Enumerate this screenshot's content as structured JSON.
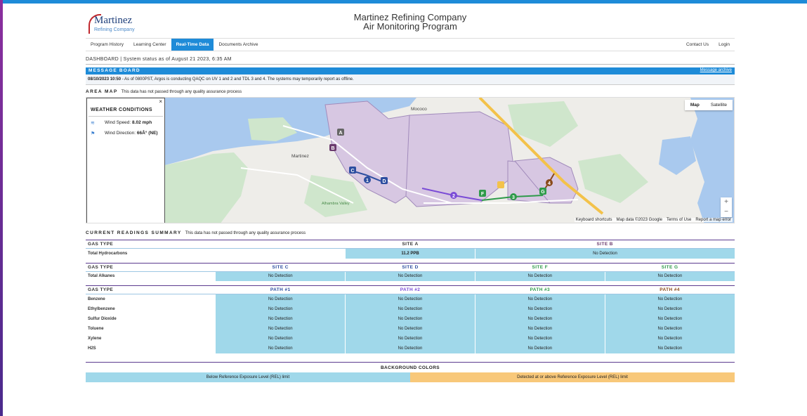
{
  "header": {
    "logo_name": "Martinez",
    "logo_sub": "Refining Company",
    "title_line1": "Martinez Refining Company",
    "title_line2": "Air Monitoring Program"
  },
  "nav": {
    "items": [
      "Program History",
      "Learning Center",
      "Real-Time Data",
      "Documents Archive"
    ],
    "active": "Real-Time Data",
    "right": [
      "Contact Us",
      "Login"
    ]
  },
  "dashboard": "DASHBOARD | System status as of August 21 2023, 6:35 AM",
  "message_board": {
    "title": "MESSAGE BOARD",
    "archive_link": "Message archive",
    "date": "08/10/2023 10:50",
    "text": " - As of 0800PST, Argos is conducting QAQC on UV 1 and 2 and TDL 3 and 4. The systems may temporarily report as offline."
  },
  "area_map": {
    "title": "AREA MAP",
    "note": "This data has not passed through any quality assurance process",
    "weather": {
      "title": "WEATHER CONDITIONS",
      "close": "×",
      "wind_speed_label": "Wind Speed: ",
      "wind_speed_value": "8.02 mph",
      "wind_dir_label": "Wind Direction: ",
      "wind_dir_value": "66Â° (NE)"
    },
    "map_type": [
      "Map",
      "Satellite"
    ],
    "zoom": [
      "+",
      "−"
    ],
    "footer": [
      "Keyboard shortcuts",
      "Map data ©2023 Google",
      "Terms of Use",
      "Report a map error"
    ],
    "place_labels": [
      "Martinez",
      "Mococo",
      "Alhambra Valley"
    ],
    "markers": {
      "sites": [
        "A",
        "B",
        "C",
        "D",
        "F",
        "G"
      ],
      "paths": [
        "1",
        "2",
        "3",
        "4"
      ]
    }
  },
  "readings": {
    "title": "CURRENT READINGS SUMMARY",
    "note": "This data has not passed through any quality assurance process",
    "table1": {
      "label_header": "GAS TYPE",
      "columns": [
        "SITE A",
        "SITE B"
      ],
      "rows": [
        {
          "gas": "Total Hydrocarbons",
          "values": [
            "11.2 PPB",
            "No Detection"
          ]
        }
      ]
    },
    "table2": {
      "label_header": "GAS TYPE",
      "columns": [
        "SITE C",
        "SITE D",
        "SITE F",
        "SITE G"
      ],
      "rows": [
        {
          "gas": "Total Alkanes",
          "values": [
            "No Detection",
            "No Detection",
            "No Detection",
            "No Detection"
          ]
        }
      ]
    },
    "table3": {
      "label_header": "GAS TYPE",
      "columns": [
        "PATH #1",
        "PATH #2",
        "PATH #3",
        "PATH #4"
      ],
      "rows": [
        {
          "gas": "Benzene",
          "values": [
            "No Detection",
            "No Detection",
            "No Detection",
            "No Detection"
          ]
        },
        {
          "gas": "Ethylbenzene",
          "values": [
            "No Detection",
            "No Detection",
            "No Detection",
            "No Detection"
          ]
        },
        {
          "gas": "Sulfur Dioxide",
          "values": [
            "No Detection",
            "No Detection",
            "No Detection",
            "No Detection"
          ]
        },
        {
          "gas": "Toluene",
          "values": [
            "No Detection",
            "No Detection",
            "No Detection",
            "No Detection"
          ]
        },
        {
          "gas": "Xylene",
          "values": [
            "No Detection",
            "No Detection",
            "No Detection",
            "No Detection"
          ]
        },
        {
          "gas": "H2S",
          "values": [
            "No Detection",
            "No Detection",
            "No Detection",
            "No Detection"
          ]
        }
      ]
    }
  },
  "background_colors": {
    "title": "BACKGROUND COLORS",
    "below": "Below Reference Exposure Level (REL) limit",
    "above": "Detected at or above Reference Exposure Level (REL) limit",
    "below_color": "#a0d8ea",
    "above_color": "#f8c87a"
  },
  "colors": {
    "accent": "#1e8bd8",
    "path1": "#2d4ea0",
    "path2": "#7a4bd6",
    "path3": "#2e9a4a",
    "path4": "#8a4a1a"
  }
}
